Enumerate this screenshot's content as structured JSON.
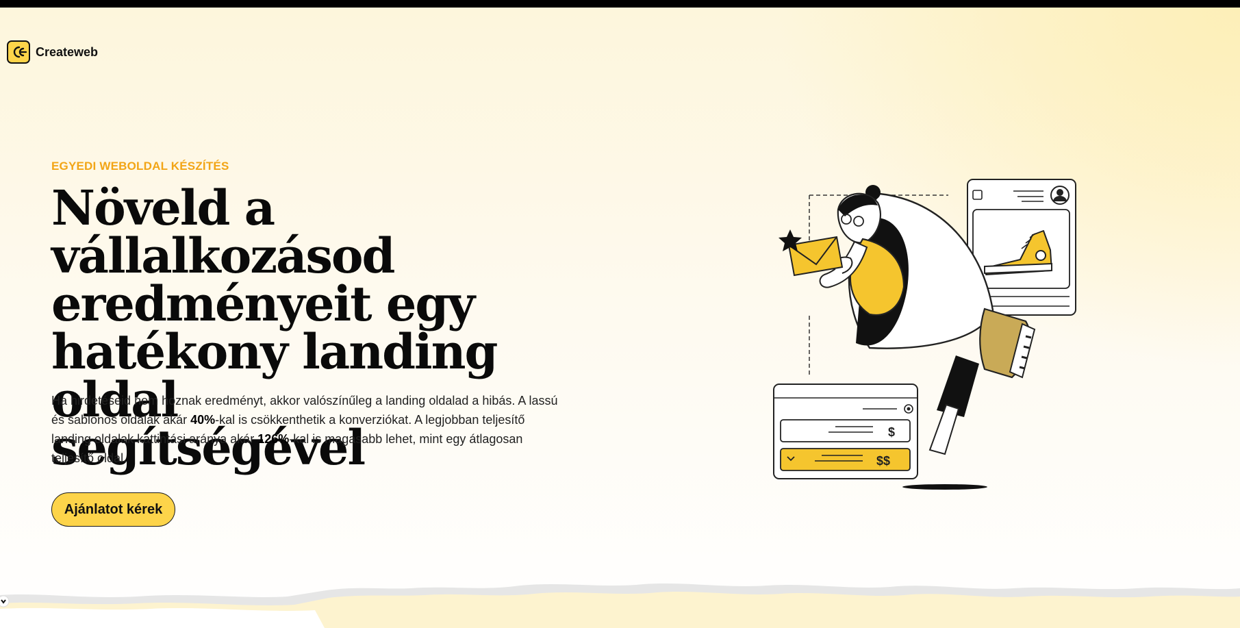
{
  "brand": {
    "name": "Createweb",
    "accent_color": "#fdd44a",
    "eyebrow_color": "#f2a516"
  },
  "hero": {
    "eyebrow": "EGYEDI WEBOLDAL KÉSZÍTÉS",
    "headline_lines": [
      "Növeld a vállalkozásod",
      "eredményeit egy",
      "hatékony landing oldal",
      "segítségével"
    ],
    "lead": {
      "part1": "Ha hirdetéseid nem hoznak eredményt, akkor valószínűleg a landing oldalad a hibás. A lassú és sablonos oldalak akár ",
      "stat1": "40%",
      "part2": "-kal is csökkenthetik a konverziókat. A legjobban teljesítő landing oldalak kattintási aránya akár ",
      "stat2": "126%",
      "part3": "-kal is magasabb lehet, mint egy átlagosan teljesítő oldal."
    },
    "cta_label": "Ajánlatot kérek"
  },
  "illustration": {
    "icons": [
      "megaphone-icon",
      "star-icon",
      "envelope-icon",
      "sneaker-icon",
      "user-avatar-icon",
      "dollar-icon",
      "chevron-down-icon"
    ]
  }
}
